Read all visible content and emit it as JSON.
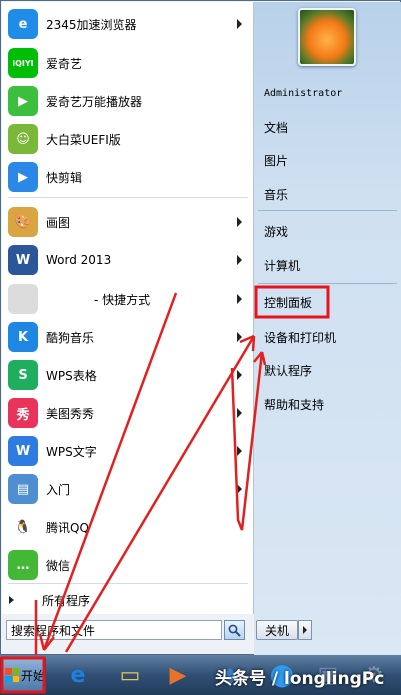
{
  "programs": [
    {
      "label": "2345加速浏览器",
      "icon": "2345-browser-icon",
      "icon_text": "e",
      "color": "#1f8de8",
      "has_arrow": true
    },
    {
      "label": "爱奇艺",
      "icon": "iqiyi-icon",
      "icon_text": "iQIYI",
      "color": "#00be06",
      "has_arrow": false
    },
    {
      "label": "爱奇艺万能播放器",
      "icon": "iqiyi-player-icon",
      "icon_text": "▶",
      "color": "#3cbf3c",
      "has_arrow": false
    },
    {
      "label": "大白菜UEFI版",
      "icon": "dabaicai-icon",
      "icon_text": "☺",
      "color": "#7ab83a",
      "has_arrow": false
    },
    {
      "label": "快剪辑",
      "icon": "kuaijianji-icon",
      "icon_text": "▶",
      "color": "#2b88e6",
      "has_arrow": false
    },
    {
      "label": "画图",
      "icon": "paint-icon",
      "icon_text": "🎨",
      "color": "#d9a441",
      "has_arrow": true
    },
    {
      "label": "Word 2013",
      "icon": "word-icon",
      "icon_text": "W",
      "color": "#2b579a",
      "has_arrow": true
    },
    {
      "label": "- 快捷方式",
      "icon": "shortcut-icon",
      "icon_text": "",
      "color": "#dcdcdc",
      "has_arrow": true
    },
    {
      "label": "酷狗音乐",
      "icon": "kugou-icon",
      "icon_text": "K",
      "color": "#1e86e3",
      "has_arrow": true
    },
    {
      "label": "WPS表格",
      "icon": "wps-sheet-icon",
      "icon_text": "S",
      "color": "#1eae5e",
      "has_arrow": true
    },
    {
      "label": "美图秀秀",
      "icon": "meitu-icon",
      "icon_text": "秀",
      "color": "#e8345a",
      "has_arrow": true
    },
    {
      "label": "WPS文字",
      "icon": "wps-writer-icon",
      "icon_text": "W",
      "color": "#2f7ce0",
      "has_arrow": true
    },
    {
      "label": "入门",
      "icon": "getting-started-icon",
      "icon_text": "▤",
      "color": "#4f8fd1",
      "has_arrow": true
    },
    {
      "label": "腾讯QQ",
      "icon": "qq-icon",
      "icon_text": "🐧",
      "color": "#ffffff",
      "has_arrow": false
    },
    {
      "label": "微信",
      "icon": "wechat-icon",
      "icon_text": "…",
      "color": "#43b837",
      "has_arrow": false
    }
  ],
  "all_programs_label": "所有程序",
  "search": {
    "placeholder": "搜索程序和文件",
    "value": "搜索程序和文件"
  },
  "right": {
    "username": "Administrator",
    "group1": [
      "文档",
      "图片",
      "音乐"
    ],
    "group2": [
      "游戏",
      "计算机"
    ],
    "group3": [
      "控制面板",
      "设备和打印机",
      "默认程序",
      "帮助和支持"
    ]
  },
  "shutdown_label": "关机",
  "start_label": "开始",
  "taskbar_icons": [
    "ie-icon",
    "explorer-icon",
    "media-player-icon",
    "app-icon",
    "browser-icon",
    "window-icon",
    "settings-icon"
  ],
  "watermark": "头条号 / longlingPc",
  "colors": {
    "highlight_box": "#e8141b",
    "annotation_arrow": "#e32020"
  }
}
